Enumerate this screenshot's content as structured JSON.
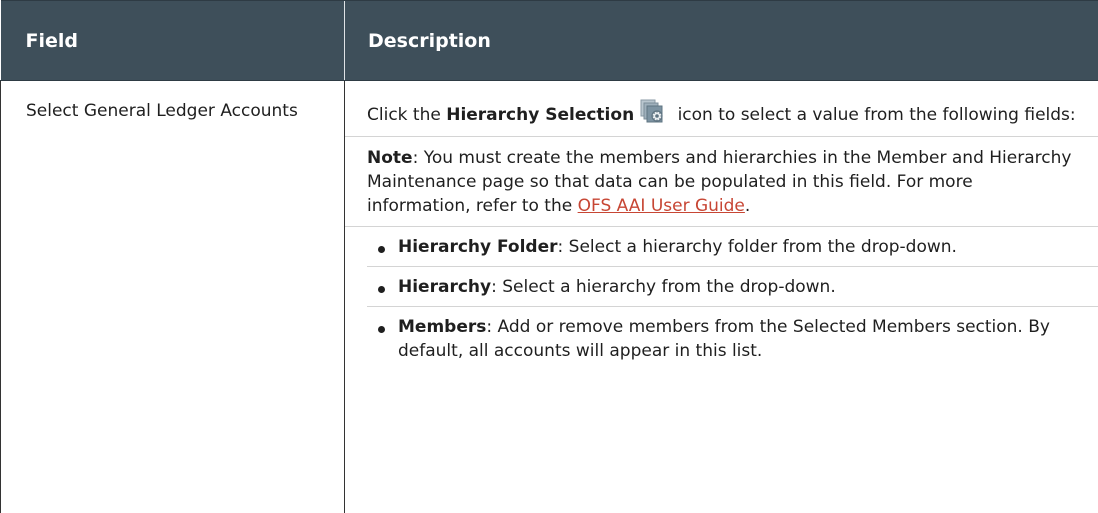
{
  "table": {
    "headers": {
      "field": "Field",
      "description": "Description"
    },
    "row": {
      "field": "Select General Ledger Accounts",
      "intro": {
        "before": "Click the ",
        "bold": "Hierarchy Selection",
        "icon": "hierarchy-selection-icon",
        "after": " icon to select a value from the following fields:"
      },
      "note": {
        "label": "Note",
        "text": ": You must create the members and hierarchies in the Member and Hierarchy Maintenance page so that data can be populated in this field. For more information, refer to the ",
        "link": "OFS AAI User Guide",
        "end": "."
      },
      "bullets": [
        {
          "term": "Hierarchy Folder",
          "text": ": Select a hierarchy folder from the drop-down."
        },
        {
          "term": "Hierarchy",
          "text": ": Select a hierarchy from the drop-down."
        },
        {
          "term": "Members",
          "text": ": Add or remove members from the Selected Members section. By default, all accounts will appear in this list."
        }
      ]
    }
  },
  "colors": {
    "header_bg": "#3e4f5a",
    "header_text": "#ffffff",
    "link": "#c74634"
  }
}
